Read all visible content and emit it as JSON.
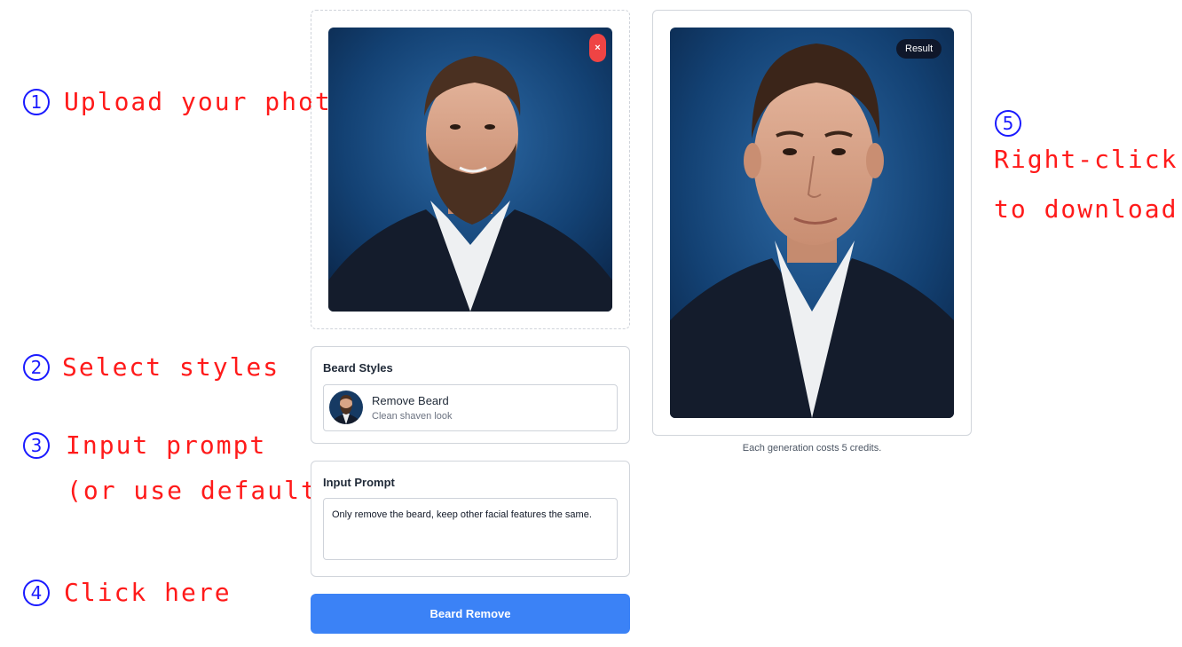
{
  "steps": [
    {
      "num": "1",
      "text": "Upload your photo"
    },
    {
      "num": "2",
      "text": "Select styles"
    },
    {
      "num": "3",
      "text": "Input prompt",
      "text2": "(or use default)"
    },
    {
      "num": "4",
      "text": "Click here"
    },
    {
      "num": "5",
      "text": "Right-click",
      "text2": "to download"
    }
  ],
  "upload": {
    "remove_label": "×"
  },
  "styles_card": {
    "title": "Beard Styles",
    "option_name": "Remove Beard",
    "option_desc": "Clean shaven look"
  },
  "prompt_card": {
    "title": "Input Prompt",
    "value": "Only remove the beard, keep other facial features the same."
  },
  "action": {
    "label": "Beard Remove"
  },
  "result": {
    "badge": "Result",
    "credits_note": "Each generation costs 5 credits."
  },
  "colors": {
    "accent": "#3b82f6",
    "annotation_text": "#ff1a1a",
    "annotation_circle": "#1a1aff",
    "remove": "#ef4444"
  }
}
